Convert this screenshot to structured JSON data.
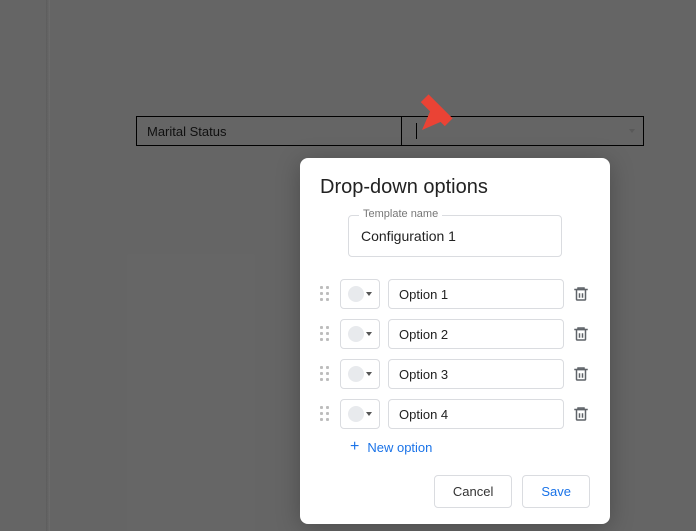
{
  "table": {
    "label_cell": "Marital Status"
  },
  "dialog": {
    "title": "Drop-down options",
    "template_label": "Template name",
    "template_value": "Configuration 1",
    "options": [
      {
        "label": "Option 1"
      },
      {
        "label": "Option 2"
      },
      {
        "label": "Option 3"
      },
      {
        "label": "Option 4"
      }
    ],
    "new_option_label": "New option",
    "cancel_label": "Cancel",
    "save_label": "Save"
  },
  "colors": {
    "accent": "#1a73e8",
    "arrow": "#ea4335"
  }
}
